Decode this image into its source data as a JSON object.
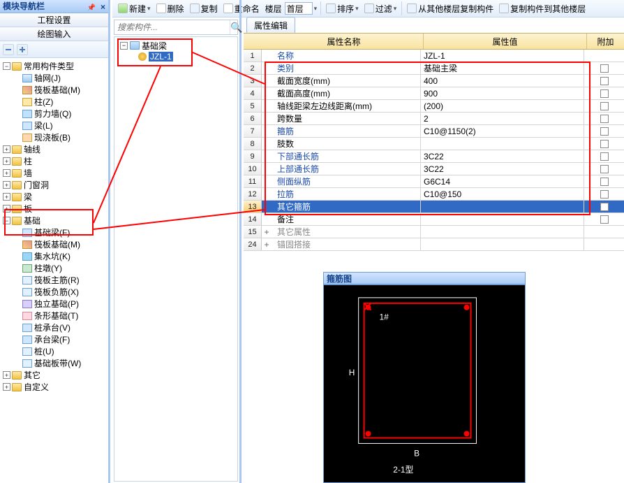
{
  "nav": {
    "title": "模块导航栏",
    "sub1": "工程设置",
    "sub2": "绘图输入",
    "root": "常用构件类型",
    "items_root": [
      {
        "t": "轴网(J)"
      },
      {
        "t": "筏板基础(M)"
      },
      {
        "t": "柱(Z)"
      },
      {
        "t": "剪力墙(Q)"
      },
      {
        "t": "梁(L)"
      },
      {
        "t": "现浇板(B)"
      }
    ],
    "groups": [
      "轴线",
      "柱",
      "墙",
      "门窗洞",
      "梁",
      "板"
    ],
    "jichu": "基础",
    "jichu_items": [
      {
        "t": "基础梁(F)"
      },
      {
        "t": "筏板基础(M)"
      },
      {
        "t": "集水坑(K)"
      },
      {
        "t": "柱墩(Y)"
      },
      {
        "t": "筏板主筋(R)"
      },
      {
        "t": "筏板负筋(X)"
      },
      {
        "t": "独立基础(P)"
      },
      {
        "t": "条形基础(T)"
      },
      {
        "t": "桩承台(V)"
      },
      {
        "t": "承台梁(F)"
      },
      {
        "t": "桩(U)"
      },
      {
        "t": "基础板带(W)"
      }
    ],
    "tail": [
      "其它",
      "自定义"
    ]
  },
  "toolbar": {
    "new": "新建",
    "del": "删除",
    "copy": "复制",
    "rename": "重命名",
    "floor_lbl": "楼层",
    "floor_val": "首层",
    "sort": "排序",
    "filter": "过滤",
    "copyfrom": "从其他楼层复制构件",
    "copyto": "复制构件到其他楼层"
  },
  "search": {
    "placeholder": "搜索构件..."
  },
  "ctree": {
    "parent": "基础梁",
    "child": "JZL-1"
  },
  "prop": {
    "tab": "属性编辑",
    "h_name": "属性名称",
    "h_val": "属性值",
    "h_add": "附加",
    "rows": [
      {
        "n": "1",
        "name": "名称",
        "val": "JZL-1",
        "link": 1,
        "cb": 0
      },
      {
        "n": "2",
        "name": "类别",
        "val": "基础主梁",
        "link": 1,
        "cb": 1
      },
      {
        "n": "3",
        "name": "截面宽度(mm)",
        "val": "400",
        "link": 0,
        "cb": 1
      },
      {
        "n": "4",
        "name": "截面高度(mm)",
        "val": "900",
        "link": 0,
        "cb": 1
      },
      {
        "n": "5",
        "name": "轴线距梁左边线距离(mm)",
        "val": "(200)",
        "link": 0,
        "cb": 1
      },
      {
        "n": "6",
        "name": "跨数量",
        "val": "2",
        "link": 0,
        "cb": 1
      },
      {
        "n": "7",
        "name": "箍筋",
        "val": "C10@1150(2)",
        "link": 1,
        "cb": 1
      },
      {
        "n": "8",
        "name": "肢数",
        "val": "",
        "link": 0,
        "cb": 1
      },
      {
        "n": "9",
        "name": "下部通长筋",
        "val": "3C22",
        "link": 1,
        "cb": 1
      },
      {
        "n": "10",
        "name": "上部通长筋",
        "val": "3C22",
        "link": 1,
        "cb": 1
      },
      {
        "n": "11",
        "name": "侧面纵筋",
        "val": "G6C14",
        "link": 1,
        "cb": 1
      },
      {
        "n": "12",
        "name": "拉筋",
        "val": "C10@150",
        "link": 1,
        "cb": 1
      }
    ],
    "row13": {
      "n": "13",
      "name": "其它箍筋"
    },
    "row14": {
      "n": "14",
      "name": "备注"
    },
    "row15": {
      "n": "15",
      "name": "其它属性"
    },
    "row24": {
      "n": "24",
      "name": "锚固搭接"
    }
  },
  "diag": {
    "title": "箍筋图",
    "label1": "1#",
    "labelH": "H",
    "labelB": "B",
    "labelType": "2-1型"
  }
}
